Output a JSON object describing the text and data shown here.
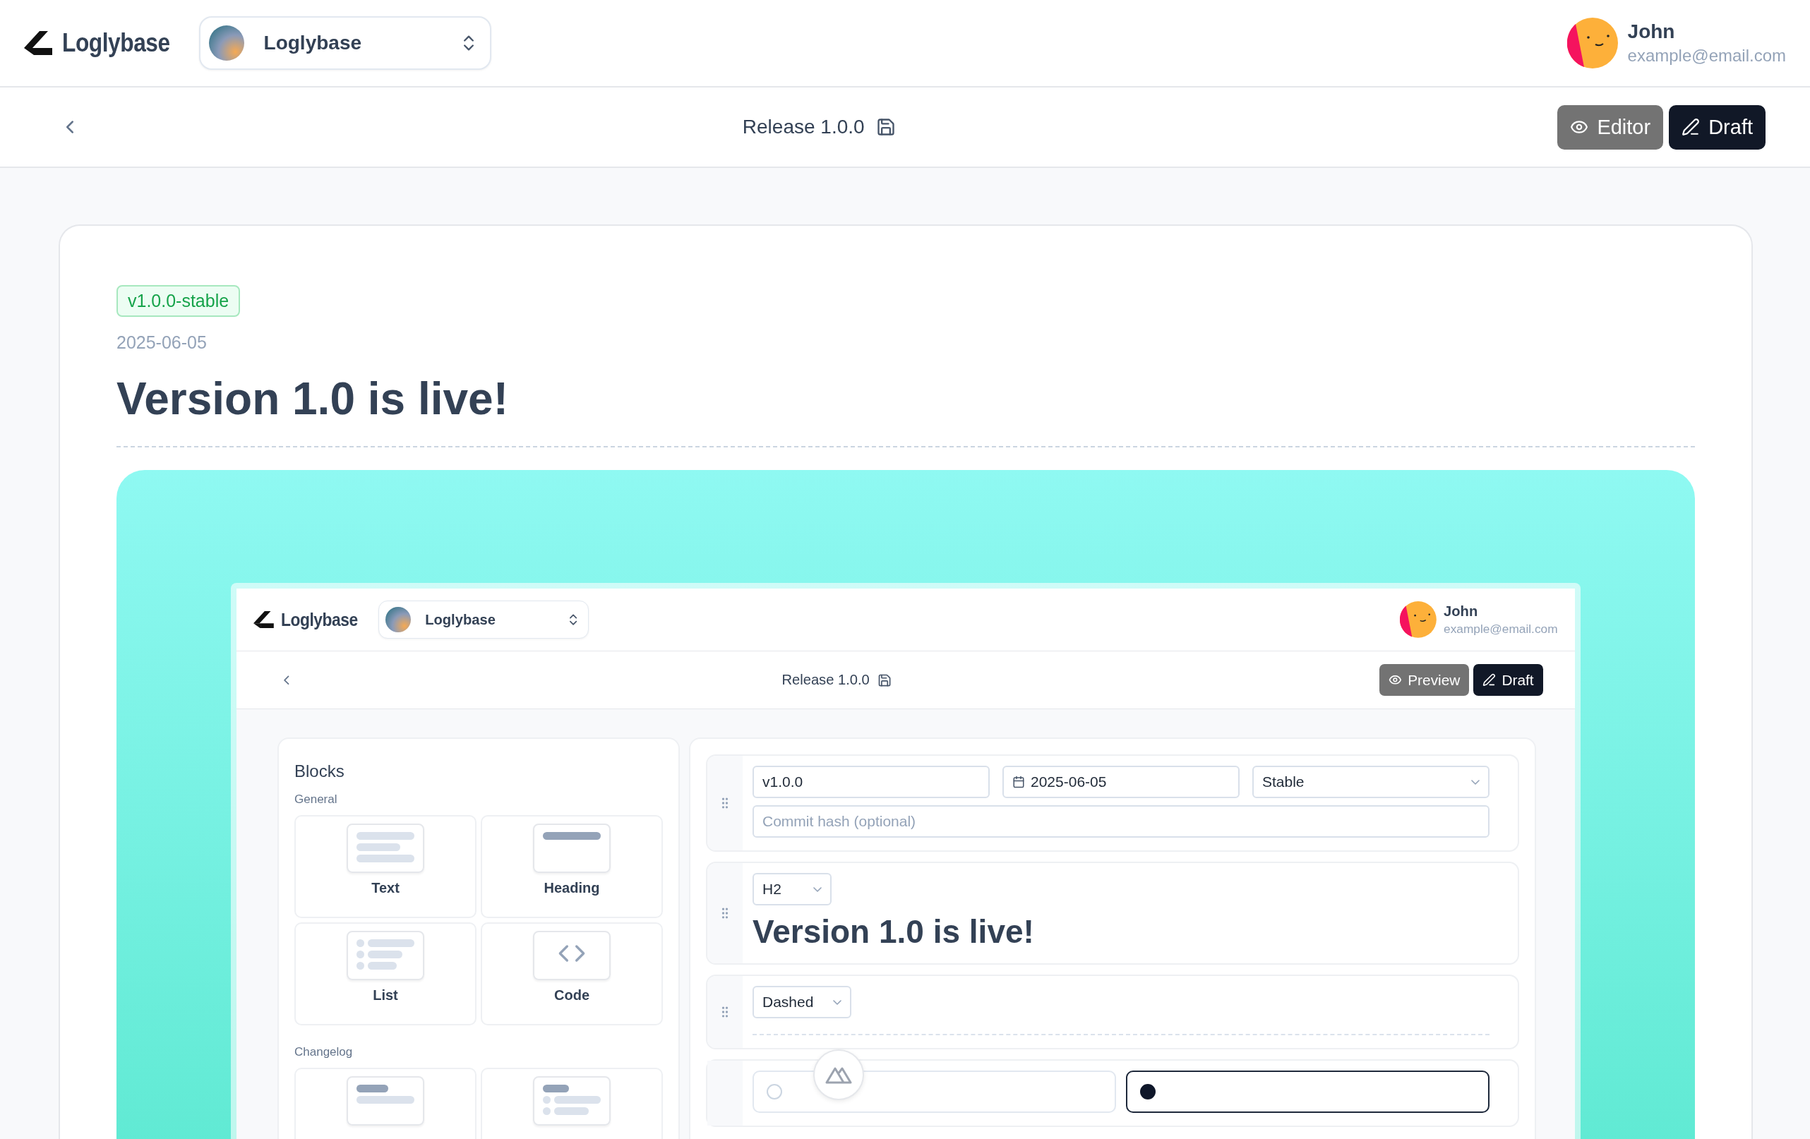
{
  "header": {
    "brand": "Loglybase",
    "project_selector": {
      "label": "Loglybase"
    },
    "user": {
      "name": "John",
      "email": "example@email.com"
    }
  },
  "toolbar": {
    "title": "Release 1.0.0",
    "buttons": [
      {
        "label": "Editor",
        "kind": "secondary"
      },
      {
        "label": "Draft",
        "kind": "primary"
      }
    ]
  },
  "entry": {
    "badge": "v1.0.0-stable",
    "date": "2025-06-05",
    "title": "Version 1.0 is live!"
  },
  "preview": {
    "header": {
      "brand": "Loglybase",
      "project_selector": {
        "label": "Loglybase"
      },
      "user": {
        "name": "John",
        "email": "example@email.com"
      }
    },
    "toolbar": {
      "title": "Release 1.0.0",
      "buttons": [
        {
          "label": "Preview",
          "kind": "secondary"
        },
        {
          "label": "Draft",
          "kind": "primary"
        }
      ]
    },
    "blocks_panel": {
      "title": "Blocks",
      "sections": [
        {
          "title": "General",
          "items": [
            {
              "label": "Text",
              "kind": "text"
            },
            {
              "label": "Heading",
              "kind": "heading"
            },
            {
              "label": "List",
              "kind": "list"
            },
            {
              "label": "Code",
              "kind": "code"
            }
          ]
        },
        {
          "title": "Changelog",
          "items": [
            {
              "kind": "heading-text"
            },
            {
              "kind": "heading-list"
            }
          ]
        }
      ]
    },
    "editor": {
      "meta": {
        "version": "v1.0.0",
        "date": "2025-06-05",
        "status": "Stable",
        "commit_placeholder": "Commit hash (optional)"
      },
      "heading": {
        "level": "H2",
        "text": "Version 1.0 is live!"
      },
      "divider": {
        "style": "Dashed"
      },
      "source": {
        "options": [
          {
            "selected": false
          },
          {
            "selected": true
          }
        ]
      }
    }
  }
}
